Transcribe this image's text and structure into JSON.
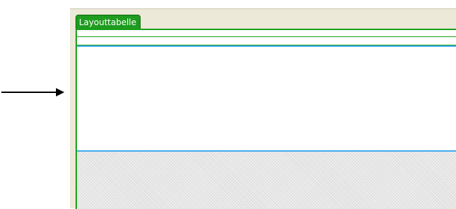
{
  "layout_table": {
    "tab_label": "Layouttabelle"
  },
  "icons": {
    "arrow": "arrow-right-icon"
  },
  "colors": {
    "tab_background": "#1f9b1f",
    "table_border": "#18a018",
    "cell_border": "#3fa9ee",
    "workspace_background": "#ece9d8",
    "empty_area": "#e4e4e4"
  }
}
